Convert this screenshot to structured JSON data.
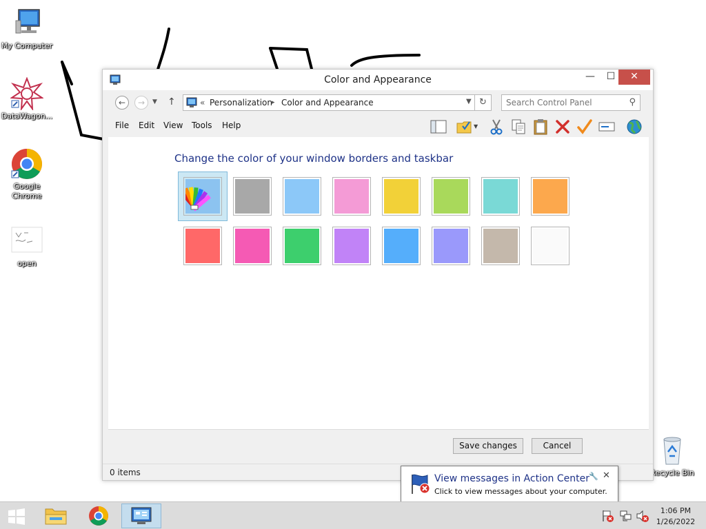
{
  "desktop": {
    "icons": [
      {
        "label": "My Computer"
      },
      {
        "label": "DataWagon..."
      },
      {
        "label": "Google Chrome"
      },
      {
        "label": "open"
      },
      {
        "label": "Recycle Bin"
      }
    ]
  },
  "window": {
    "title": "Color and Appearance",
    "controls": {
      "minimize": "—",
      "maximize": "☐",
      "close": "✕"
    },
    "address": {
      "overflow": "«",
      "crumbs": [
        "Personalization",
        "Color and Appearance"
      ],
      "separator": "▸"
    },
    "search": {
      "placeholder": "Search Control Panel"
    },
    "menu": [
      "File",
      "Edit",
      "View",
      "Tools",
      "Help"
    ],
    "heading": "Change the color of your window borders and taskbar",
    "colors": {
      "row1": [
        "#a8a8a8",
        "#8cc8f8",
        "#f49bd6",
        "#f2d138",
        "#a9d95b",
        "#7ad9d6",
        "#fca84d"
      ],
      "row2": [
        "#ff6868",
        "#f55ab4",
        "#3dcf6d",
        "#c183f7",
        "#55aefb",
        "#9a99fb",
        "#c4b8ab",
        "#fafafa"
      ]
    },
    "buttons": {
      "save": "Save changes",
      "cancel": "Cancel"
    },
    "status": "0 items"
  },
  "notification": {
    "title": "View messages in Action Center",
    "body": "Click to view messages about your computer."
  },
  "taskbar": {
    "time": "1:06 PM",
    "date": "1/26/2022"
  }
}
